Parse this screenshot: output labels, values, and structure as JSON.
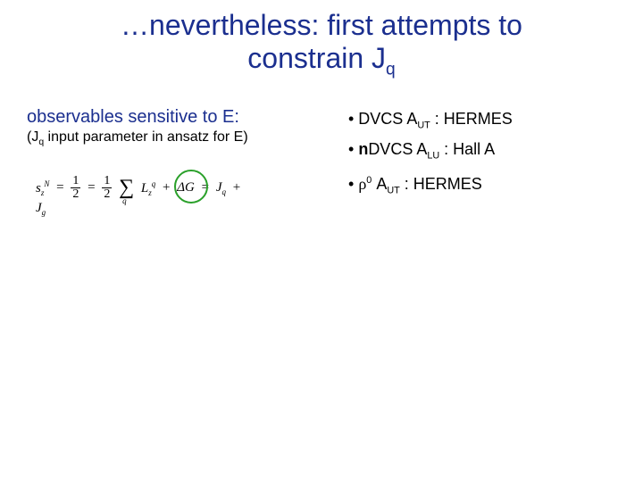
{
  "title": {
    "line1": "…nevertheless: first attempts to",
    "line2_pre": "constrain J",
    "line2_sub": "q"
  },
  "left": {
    "heading": "observables sensitive to E:",
    "note_pre": "(J",
    "note_sub": "q",
    "note_post": " input parameter in ansatz for E)"
  },
  "equation": {
    "lhs_s": "s",
    "lhs_N": "N",
    "lhs_z": "z",
    "eq": " = ",
    "half_num": "1",
    "half_den": "2",
    "minus": " = ",
    "sum": "∑",
    "sum_sub": "q",
    "Lq": "L",
    "Lq_sup": "q",
    "Lq_sub": "z",
    "plus1": " + ",
    "DG": "ΔG",
    "eq2": " = ",
    "Jq": "J",
    "Jq_sub": "q",
    "plus2": " + ",
    "Jg": "J",
    "Jg_sub": "g"
  },
  "bullets": {
    "b1_pre": "• DVCS A",
    "b1_sub": "UT",
    "b1_post": " : HERMES",
    "b2_pre": "• ",
    "b2_bold": "n",
    "b2_mid": "DVCS A",
    "b2_sub": "LU",
    "b2_post": " : Hall A",
    "b3_pre": "• ",
    "b3_rho": "ρ",
    "b3_sup": "0",
    "b3_mid": " A",
    "b3_sub": "UT",
    "b3_post": " : HERMES"
  }
}
